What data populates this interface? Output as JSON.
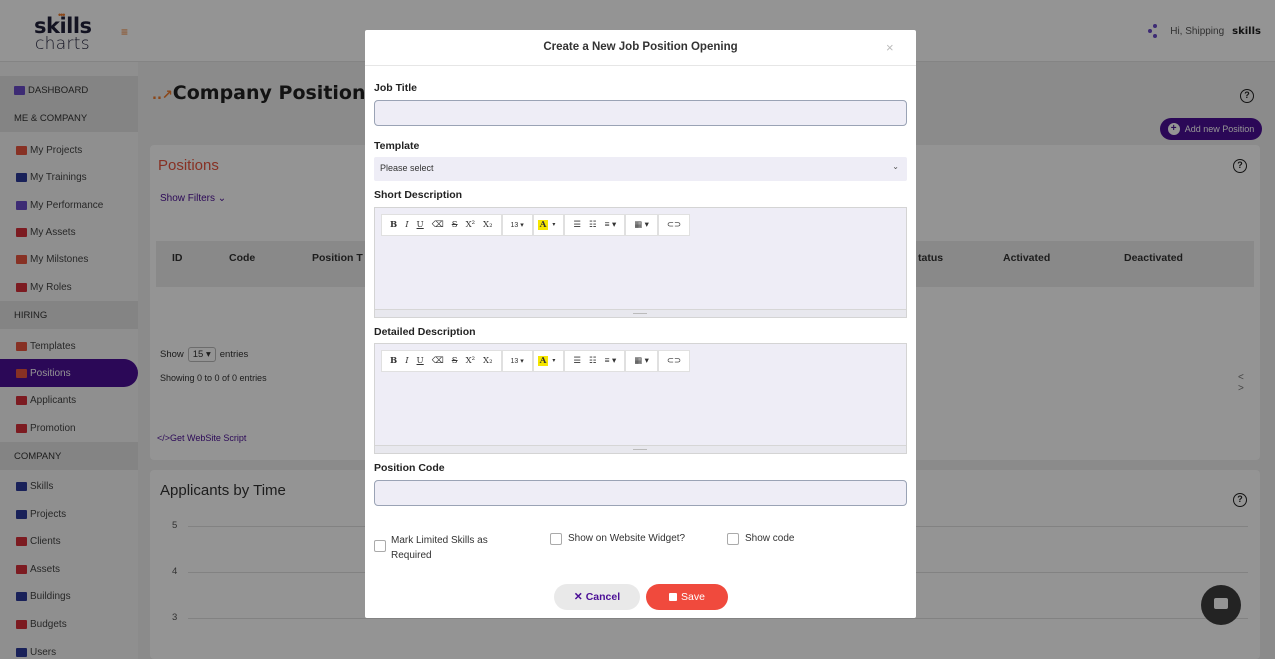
{
  "brand": {
    "word1": "skills",
    "word2": "charts"
  },
  "header": {
    "greeting": "Hi, Shipping",
    "mini_logo": "skills"
  },
  "sidebar": {
    "items": [
      {
        "label": "DASHBOARD",
        "kind": "header"
      },
      {
        "label": "ME & COMPANY",
        "kind": "header"
      },
      {
        "label": "My Projects",
        "kind": "item",
        "color": "#e8553e"
      },
      {
        "label": "My Trainings",
        "kind": "item",
        "color": "#2b3a9a"
      },
      {
        "label": "My Performance",
        "kind": "item",
        "color": "#6a4ac8"
      },
      {
        "label": "My Assets",
        "kind": "item",
        "color": "#d62f3a"
      },
      {
        "label": "My Milstones",
        "kind": "item",
        "color": "#e8553e"
      },
      {
        "label": "My Roles",
        "kind": "item",
        "color": "#d62f3a"
      },
      {
        "label": "HIRING",
        "kind": "header"
      },
      {
        "label": "Templates",
        "kind": "item",
        "color": "#e8553e"
      },
      {
        "label": "Positions",
        "kind": "active",
        "color": "#e8553e"
      },
      {
        "label": "Applicants",
        "kind": "item",
        "color": "#d62f3a"
      },
      {
        "label": "Promotion",
        "kind": "item",
        "color": "#d62f3a"
      },
      {
        "label": "COMPANY",
        "kind": "header"
      },
      {
        "label": "Skills",
        "kind": "item",
        "color": "#2b3a9a"
      },
      {
        "label": "Projects",
        "kind": "item",
        "color": "#2b3a9a"
      },
      {
        "label": "Clients",
        "kind": "item",
        "color": "#d62f3a"
      },
      {
        "label": "Assets",
        "kind": "item",
        "color": "#d62f3a"
      },
      {
        "label": "Buildings",
        "kind": "item",
        "color": "#2b3a9a"
      },
      {
        "label": "Budgets",
        "kind": "item",
        "color": "#d62f3a"
      },
      {
        "label": "Users",
        "kind": "item",
        "color": "#2b3a9a"
      }
    ]
  },
  "main": {
    "page_title": "Company Positions",
    "add_button": "Add new Position",
    "positions_title": "Positions",
    "show_filters": "Show Filters",
    "columns": [
      "ID",
      "Code",
      "Position T",
      "tatus",
      "Activated",
      "Deactivated"
    ],
    "show_label": "Show",
    "page_size": "15",
    "entries_label": "entries",
    "showing_text": "Showing 0 to 0 of 0 entries",
    "pager": "< >",
    "website_script": "Get WebSite Script",
    "applicants_title": "Applicants by Time",
    "y_ticks": [
      "5",
      "4",
      "3"
    ]
  },
  "modal": {
    "title": "Create a New Job Position Opening",
    "close": "×",
    "job_title_label": "Job Title",
    "template_label": "Template",
    "template_value": "Please select",
    "short_desc_label": "Short Description",
    "detailed_desc_label": "Detailed Description",
    "position_code_label": "Position Code",
    "toolbar": {
      "g1": [
        "B",
        "I",
        "U",
        "⌫",
        "S",
        "X²",
        "X₂"
      ],
      "font_size": "13 ▾",
      "g3": [
        "A",
        "▾"
      ],
      "g4": [
        "☰",
        "☷",
        "≡ ▾"
      ],
      "g5": [
        "▦ ▾"
      ],
      "g6": [
        "⊂⊃"
      ]
    },
    "chk_limited": "Mark Limited Skills as Required",
    "chk_widget": "Show on Website Widget?",
    "chk_code": "Show code",
    "cancel": "Cancel",
    "save": "Save"
  }
}
